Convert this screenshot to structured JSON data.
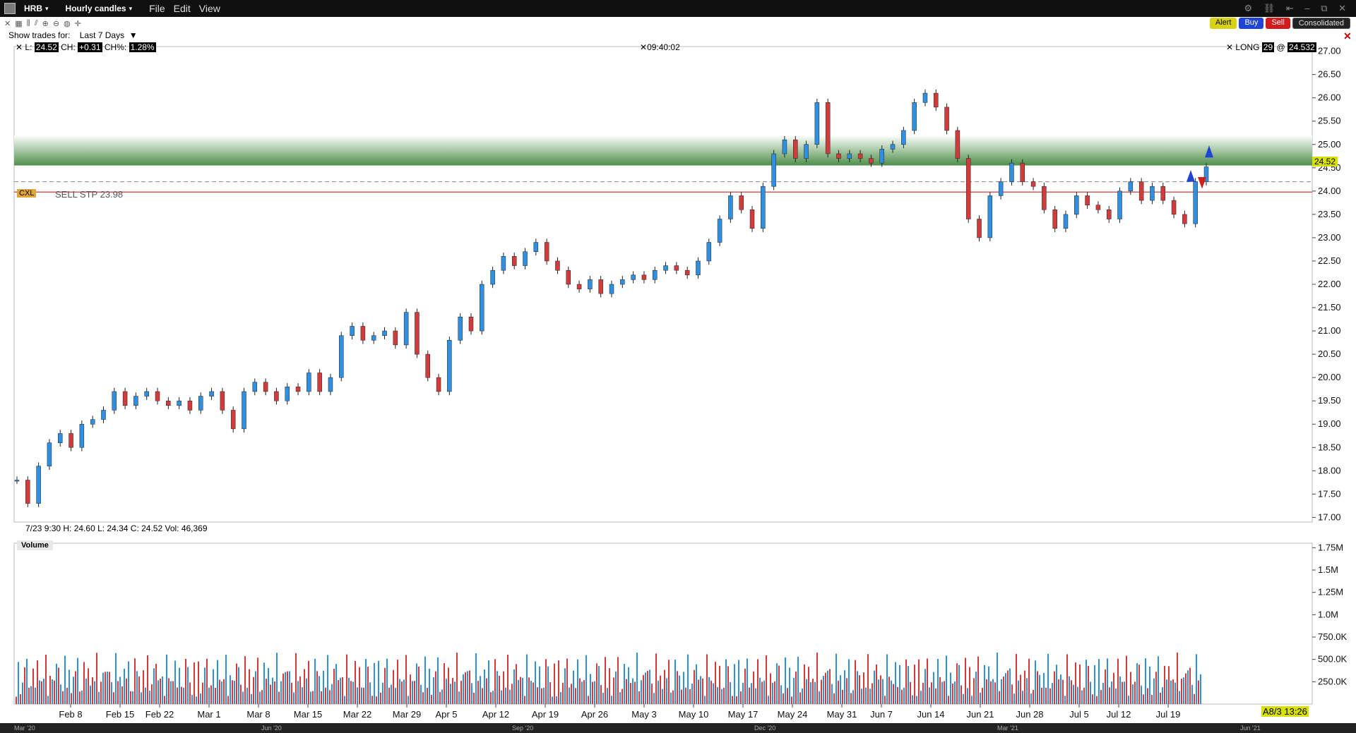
{
  "window": {
    "symbol": "HRB",
    "chart_type": "Hourly candles",
    "menu": [
      "File",
      "Edit",
      "View"
    ]
  },
  "actions": {
    "alert": "Alert",
    "buy": "Buy",
    "sell": "Sell",
    "consolidated": "Consolidated"
  },
  "show_trades": {
    "label": "Show trades for:",
    "value": "Last 7 Days"
  },
  "header": {
    "l_label": "L:",
    "l_value": "24.52",
    "ch_label": "CH:",
    "ch_value": "+0.31",
    "chp_label": "CH%:",
    "chp_value": "1.28%",
    "time": "09:40:02",
    "pos_label": "LONG",
    "pos_qty": "29",
    "pos_at": "@",
    "pos_price": "24.532"
  },
  "order": {
    "cxl": "CXL",
    "sell_stop": "SELL STP 23.98"
  },
  "last_price_tag": "24.52",
  "ohlc": "7/23 9:30   H: 24.60   L: 24.34   C: 24.52   Vol: 46,369",
  "volume_label": "Volume",
  "date_tag": "8/3 13:26",
  "date_tag_prefix": "A",
  "navigator_labels": [
    "Mar '20",
    "Jun '20",
    "Sep '20",
    "Dec '20",
    "Mar '21",
    "Jun '21"
  ],
  "colors": {
    "up": "#2f8fe0",
    "down": "#d23b3b",
    "zone": "#4f8f4a",
    "stop_line": "#d62222"
  },
  "chart_data": {
    "type": "line",
    "price_axis": {
      "ticks": [
        "27.00",
        "26.50",
        "26.00",
        "25.50",
        "25.00",
        "24.50",
        "24.00",
        "23.50",
        "23.00",
        "22.50",
        "22.00",
        "21.50",
        "21.00",
        "20.50",
        "20.00",
        "19.50",
        "19.00",
        "18.50",
        "18.00",
        "17.50",
        "17.00"
      ],
      "ylim": [
        16.9,
        27.1
      ]
    },
    "volume_axis": {
      "ticks": [
        "1.75M",
        "1.5M",
        "1.25M",
        "1.0M",
        "750.0K",
        "500.0K",
        "250.0K"
      ],
      "ylim": [
        0,
        1800000
      ]
    },
    "x_ticks": [
      "Feb 8",
      "Feb 15",
      "Feb 22",
      "Mar 1",
      "Mar 8",
      "Mar 15",
      "Mar 22",
      "Mar 29",
      "Apr 5",
      "Apr 12",
      "Apr 19",
      "Apr 26",
      "May 3",
      "May 10",
      "May 17",
      "May 24",
      "May 31",
      "Jun 7",
      "Jun 14",
      "Jun 21",
      "Jun 28",
      "Jul 5",
      "Jul 12",
      "Jul 19"
    ],
    "zone": [
      24.55,
      25.2
    ],
    "stop": 23.98,
    "avg_cost": 24.2,
    "series": [
      {
        "values": [
          17.8,
          17.3,
          18.1,
          18.6,
          18.8,
          18.5,
          19.0,
          19.1,
          19.3,
          19.7,
          19.4,
          19.6,
          19.7,
          19.5,
          19.4,
          19.5,
          19.3,
          19.6,
          19.7,
          19.3,
          18.9,
          19.7,
          19.9,
          19.7,
          19.5,
          19.8,
          19.7,
          20.1,
          19.7,
          20.0,
          20.9,
          21.1,
          20.8,
          20.9,
          21.0,
          20.7,
          21.4,
          20.5,
          20.0,
          19.7,
          20.8,
          21.3,
          21.0,
          22.0,
          22.3,
          22.6,
          22.4,
          22.7,
          22.9,
          22.5,
          22.3,
          22.0,
          21.9,
          22.1,
          21.8,
          22.0,
          22.1,
          22.2,
          22.1,
          22.3,
          22.4,
          22.3,
          22.2,
          22.5,
          22.9,
          23.4,
          23.9,
          23.6,
          23.2,
          24.1,
          24.8,
          25.1,
          24.7,
          25.0,
          25.9,
          24.8,
          24.7,
          24.8,
          24.7,
          24.6,
          24.9,
          25.0,
          25.3,
          25.9,
          26.1,
          25.8,
          25.3,
          24.7,
          23.4,
          23.0,
          23.9,
          24.2,
          24.6,
          24.2,
          24.1,
          23.6,
          23.2,
          23.5,
          23.9,
          23.7,
          23.6,
          23.4,
          24.0,
          24.2,
          23.8,
          24.1,
          23.8,
          23.5,
          23.3,
          24.2,
          24.52
        ]
      }
    ]
  }
}
